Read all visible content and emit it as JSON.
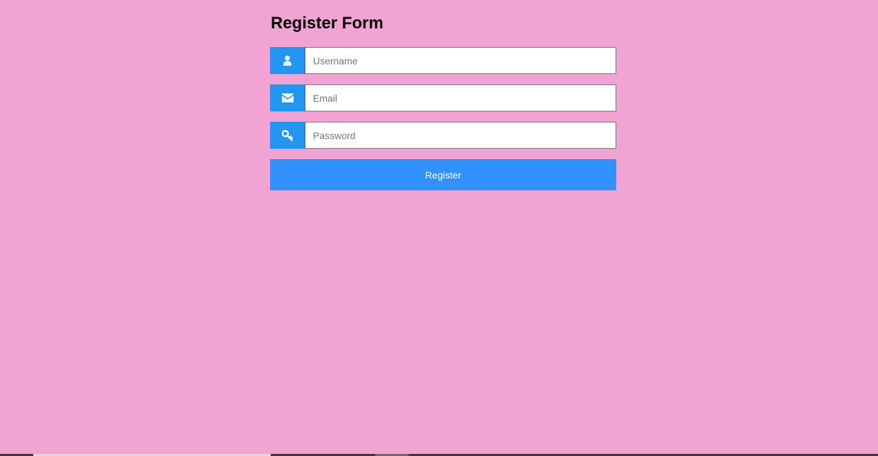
{
  "form": {
    "title": "Register Form",
    "fields": [
      {
        "name": "username",
        "icon": "user-icon",
        "placeholder": "Username",
        "value": ""
      },
      {
        "name": "email",
        "icon": "envelope-icon",
        "placeholder": "Email",
        "value": ""
      },
      {
        "name": "password",
        "icon": "key-icon",
        "placeholder": "Password",
        "value": ""
      }
    ],
    "submit_label": "Register"
  },
  "colors": {
    "background": "#f1a4d3",
    "accent": "#2196f3",
    "button": "#3192fb",
    "button_text": "#ffffff",
    "title_text": "#000000"
  }
}
